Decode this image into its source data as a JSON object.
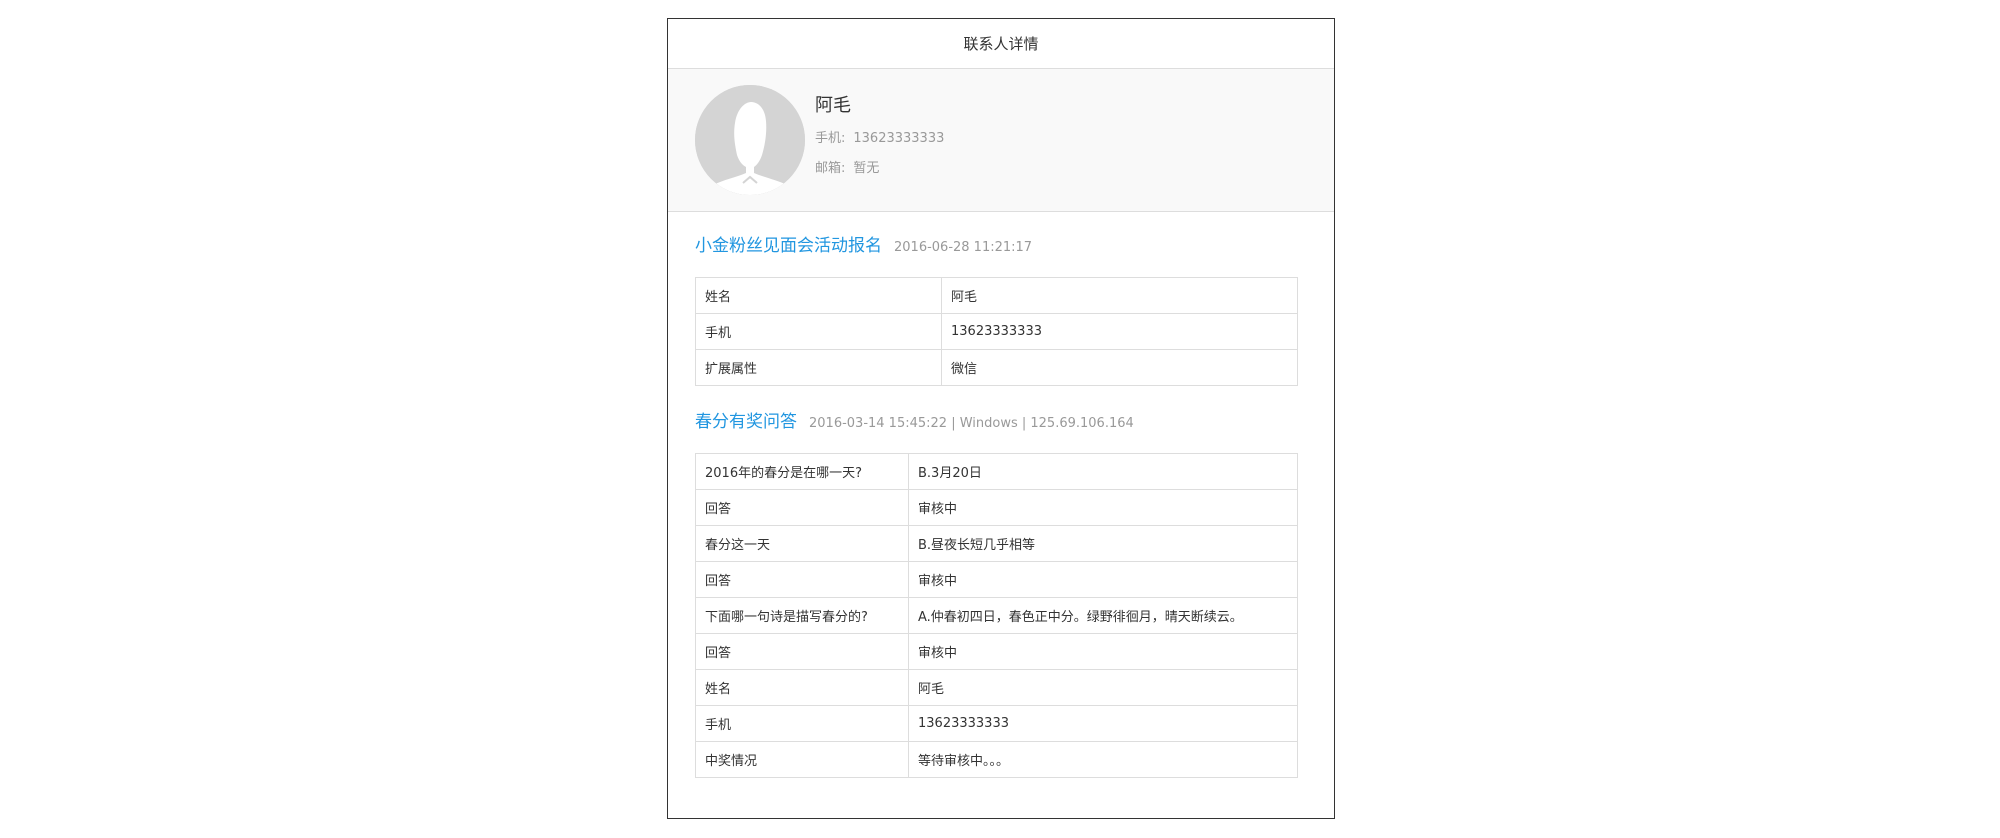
{
  "header": {
    "title": "联系人详情"
  },
  "profile": {
    "name": "阿毛",
    "phone_label": "手机:",
    "phone": "13623333333",
    "email_label": "邮箱:",
    "email": "暂无"
  },
  "sections": [
    {
      "title": "小金粉丝见面会活动报名",
      "meta": "2016-06-28 11:21:17",
      "rows": [
        {
          "key": "姓名",
          "value": "阿毛"
        },
        {
          "key": "手机",
          "value": "13623333333"
        },
        {
          "key": "扩展属性",
          "value": "微信"
        }
      ]
    },
    {
      "title": "春分有奖问答",
      "meta": "2016-03-14 15:45:22 | Windows | 125.69.106.164",
      "rows": [
        {
          "key": "2016年的春分是在哪一天?",
          "value": "B.3月20日"
        },
        {
          "key": "回答",
          "value": "审核中"
        },
        {
          "key": "春分这一天",
          "value": "B.昼夜长短几乎相等"
        },
        {
          "key": "回答",
          "value": "审核中"
        },
        {
          "key": "下面哪一句诗是描写春分的?",
          "value": "A.仲春初四日，春色正中分。绿野徘徊月，晴天断续云。"
        },
        {
          "key": "回答",
          "value": "审核中"
        },
        {
          "key": "姓名",
          "value": "阿毛"
        },
        {
          "key": "手机",
          "value": "13623333333"
        },
        {
          "key": "中奖情况",
          "value": "等待审核中。。。"
        }
      ]
    }
  ],
  "colors": {
    "accent": "#2196e0",
    "muted": "#999999",
    "text": "#333333",
    "border": "#dddddd"
  },
  "icons": {
    "avatar": "default-user-silhouette"
  }
}
